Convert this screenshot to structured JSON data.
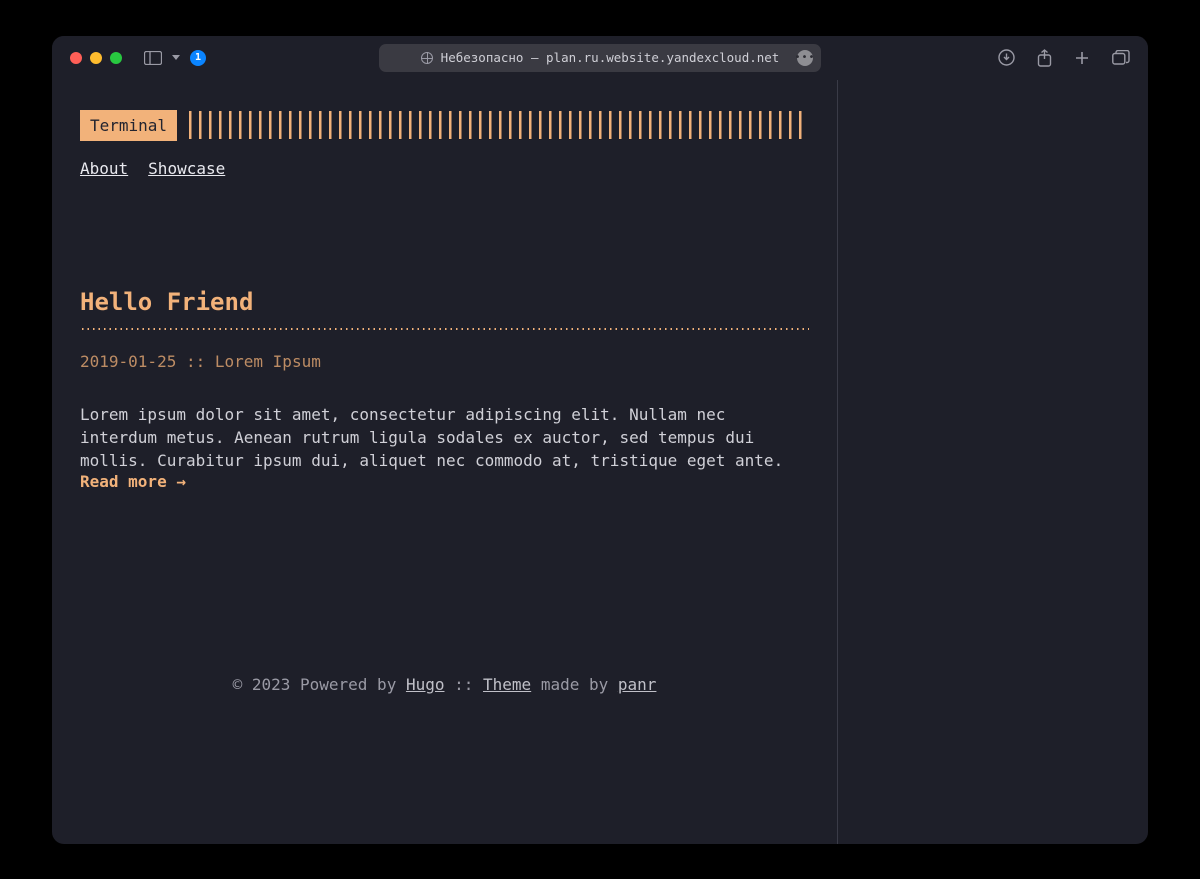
{
  "browser": {
    "address_label": "Небезопасно — plan.ru.website.yandexcloud.net"
  },
  "site": {
    "logo": "Terminal",
    "nav": {
      "about": "About",
      "showcase": "Showcase"
    }
  },
  "post": {
    "title": "Hello Friend",
    "date": "2019-01-25",
    "sep": "::",
    "author": "Lorem Ipsum",
    "excerpt": "Lorem ipsum dolor sit amet, consectetur adipiscing elit. Nullam nec interdum metus. Aenean rutrum ligula sodales ex auctor, sed tempus dui mollis. Curabitur ipsum dui, aliquet nec commodo at, tristique eget ante.",
    "read_more": "Read more →"
  },
  "footer": {
    "copyright_prefix": "© 2023 Powered by ",
    "hugo": "Hugo",
    "sep": " :: ",
    "theme": "Theme",
    "made_by": " made by ",
    "panr": "panr"
  },
  "colors": {
    "accent": "#f2b27a",
    "bg": "#1e1f29"
  }
}
